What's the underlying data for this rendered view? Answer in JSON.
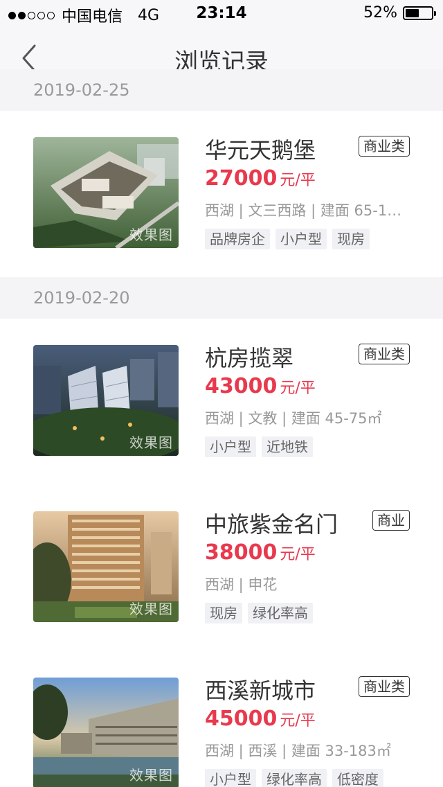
{
  "status_bar": {
    "carrier": "中国电信",
    "network": "4G",
    "time": "23:14",
    "battery_text": "52%",
    "battery_level": 0.52,
    "signal_filled": 2,
    "signal_total": 5
  },
  "nav": {
    "title": "浏览记录",
    "back_icon": "chevron-left-icon"
  },
  "groups": [
    {
      "date": "2019-02-25",
      "listings": [
        {
          "name": "华元天鹅堡",
          "type_badge": "商业类",
          "price_value": "27000",
          "price_unit": "元/平",
          "details": "西湖 | 文三西路 | 建面 65-1…",
          "tags": [
            "品牌房企",
            "小户型",
            "现房"
          ],
          "watermark": "效果图"
        }
      ]
    },
    {
      "date": "2019-02-20",
      "listings": [
        {
          "name": "杭房揽翠",
          "type_badge": "商业类",
          "price_value": "43000",
          "price_unit": "元/平",
          "details": "西湖 | 文教 | 建面 45-75㎡",
          "tags": [
            "小户型",
            "近地铁"
          ],
          "watermark": "效果图"
        },
        {
          "name": "中旅紫金名门",
          "type_badge": "商业",
          "price_value": "38000",
          "price_unit": "元/平",
          "details": "西湖 | 申花",
          "tags": [
            "现房",
            "绿化率高"
          ],
          "watermark": "效果图"
        },
        {
          "name": "西溪新城市",
          "type_badge": "商业类",
          "price_value": "45000",
          "price_unit": "元/平",
          "details": "西湖 | 西溪 | 建面 33-183㎡",
          "tags": [
            "小户型",
            "绿化率高",
            "低密度"
          ],
          "watermark": "效果图"
        }
      ]
    }
  ],
  "colors": {
    "price": "#e8394d",
    "header_bg": "#f7f7f9",
    "date_bg": "#f4f4f6"
  }
}
